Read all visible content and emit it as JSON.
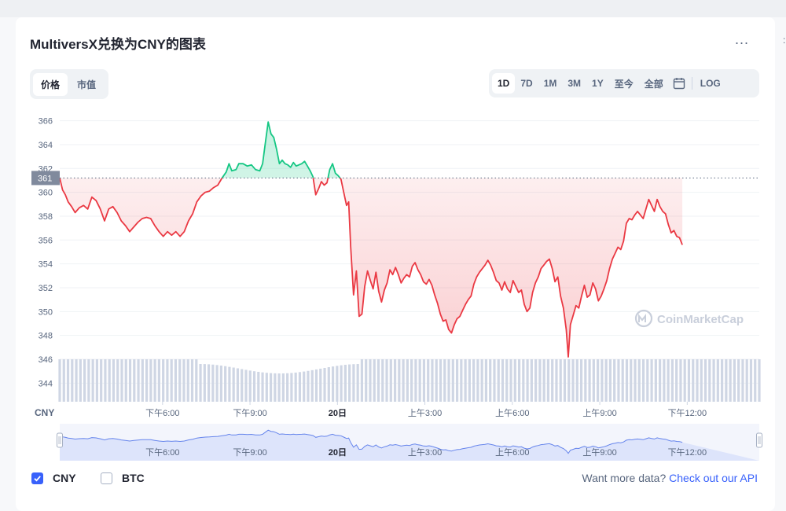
{
  "title": "MultiversX兑换为CNY的图表",
  "more_label": "...",
  "edge_char": ":",
  "metric_tabs": [
    {
      "label": "价格",
      "active": true
    },
    {
      "label": "市值",
      "active": false
    }
  ],
  "range_tabs": [
    {
      "label": "1D",
      "active": true
    },
    {
      "label": "7D",
      "active": false
    },
    {
      "label": "1M",
      "active": false
    },
    {
      "label": "3M",
      "active": false
    },
    {
      "label": "1Y",
      "active": false
    },
    {
      "label": "至今",
      "active": false
    },
    {
      "label": "全部",
      "active": false
    }
  ],
  "calendar_icon": "calendar-icon",
  "log_label": "LOG",
  "legend": [
    {
      "label": "CNY",
      "checked": true
    },
    {
      "label": "BTC",
      "checked": false
    }
  ],
  "more_data": {
    "text": "Want more data? ",
    "link": "Check out our API"
  },
  "watermark": "CoinMarketCap",
  "colors": {
    "up": "#16c784",
    "down": "#ea3943",
    "accent": "#3861fb",
    "volume": "#cfd6e4",
    "navigator_fill": "#dde4fb",
    "navigator_line": "#6685ec"
  },
  "chart_data": {
    "type": "line",
    "baseline": 361.2,
    "baseline_label": "361",
    "currency_label": "CNY",
    "yticks": [
      366,
      364,
      362,
      360,
      358,
      356,
      354,
      352,
      350,
      348,
      346,
      344
    ],
    "ylim": [
      343,
      367
    ],
    "xlim": [
      0,
      1
    ],
    "xticks": [
      {
        "t": 0.147,
        "label": "下午6:00",
        "bold": false
      },
      {
        "t": 0.272,
        "label": "下午9:00",
        "bold": false
      },
      {
        "t": 0.397,
        "label": "20日",
        "bold": true
      },
      {
        "t": 0.522,
        "label": "上午3:00",
        "bold": false
      },
      {
        "t": 0.647,
        "label": "上午6:00",
        "bold": false
      },
      {
        "t": 0.772,
        "label": "上午9:00",
        "bold": false
      },
      {
        "t": 0.897,
        "label": "下午12:00",
        "bold": false
      }
    ],
    "series": [
      {
        "name": "CNY",
        "points": [
          [
            0,
            361.2
          ],
          [
            0.004,
            360.2
          ],
          [
            0.008,
            359.8
          ],
          [
            0.012,
            359.2
          ],
          [
            0.017,
            358.8
          ],
          [
            0.022,
            358.3
          ],
          [
            0.028,
            358.7
          ],
          [
            0.034,
            358.9
          ],
          [
            0.04,
            358.6
          ],
          [
            0.046,
            359.6
          ],
          [
            0.052,
            359.3
          ],
          [
            0.058,
            358.6
          ],
          [
            0.064,
            357.6
          ],
          [
            0.07,
            358.6
          ],
          [
            0.076,
            358.8
          ],
          [
            0.082,
            358.3
          ],
          [
            0.088,
            357.6
          ],
          [
            0.094,
            357.2
          ],
          [
            0.1,
            356.7
          ],
          [
            0.106,
            357.1
          ],
          [
            0.112,
            357.5
          ],
          [
            0.118,
            357.8
          ],
          [
            0.124,
            357.9
          ],
          [
            0.13,
            357.8
          ],
          [
            0.136,
            357.2
          ],
          [
            0.142,
            356.7
          ],
          [
            0.148,
            356.3
          ],
          [
            0.154,
            356.7
          ],
          [
            0.16,
            356.4
          ],
          [
            0.166,
            356.7
          ],
          [
            0.172,
            356.3
          ],
          [
            0.178,
            356.7
          ],
          [
            0.184,
            357.6
          ],
          [
            0.19,
            358.2
          ],
          [
            0.196,
            359.2
          ],
          [
            0.202,
            359.7
          ],
          [
            0.208,
            360
          ],
          [
            0.214,
            360.1
          ],
          [
            0.22,
            360.4
          ],
          [
            0.226,
            360.6
          ],
          [
            0.232,
            361.2
          ],
          [
            0.238,
            361.7
          ],
          [
            0.242,
            362.4
          ],
          [
            0.246,
            361.8
          ],
          [
            0.252,
            361.9
          ],
          [
            0.256,
            362.4
          ],
          [
            0.262,
            362.4
          ],
          [
            0.268,
            362.2
          ],
          [
            0.274,
            362.3
          ],
          [
            0.28,
            361.9
          ],
          [
            0.286,
            361.8
          ],
          [
            0.29,
            362.4
          ],
          [
            0.294,
            364.2
          ],
          [
            0.298,
            365.9
          ],
          [
            0.302,
            364.9
          ],
          [
            0.306,
            364.6
          ],
          [
            0.31,
            363.6
          ],
          [
            0.314,
            362.4
          ],
          [
            0.318,
            362.7
          ],
          [
            0.322,
            362.4
          ],
          [
            0.326,
            362.3
          ],
          [
            0.33,
            362.1
          ],
          [
            0.334,
            362.5
          ],
          [
            0.338,
            362.2
          ],
          [
            0.342,
            362.3
          ],
          [
            0.346,
            362.4
          ],
          [
            0.35,
            362.6
          ],
          [
            0.354,
            362.2
          ],
          [
            0.358,
            361.8
          ],
          [
            0.362,
            361.3
          ],
          [
            0.366,
            359.8
          ],
          [
            0.37,
            360.3
          ],
          [
            0.374,
            360.9
          ],
          [
            0.378,
            360.6
          ],
          [
            0.382,
            360.8
          ],
          [
            0.386,
            361.9
          ],
          [
            0.39,
            362.4
          ],
          [
            0.394,
            361.6
          ],
          [
            0.398,
            361.4
          ],
          [
            0.402,
            361.1
          ],
          [
            0.406,
            360
          ],
          [
            0.41,
            358.9
          ],
          [
            0.413,
            359.2
          ],
          [
            0.416,
            355.4
          ],
          [
            0.42,
            351.4
          ],
          [
            0.424,
            353.4
          ],
          [
            0.428,
            349.6
          ],
          [
            0.432,
            349.8
          ],
          [
            0.436,
            352.1
          ],
          [
            0.44,
            353.4
          ],
          [
            0.444,
            352.6
          ],
          [
            0.448,
            351.9
          ],
          [
            0.452,
            353.3
          ],
          [
            0.456,
            351.7
          ],
          [
            0.46,
            350.8
          ],
          [
            0.464,
            351.8
          ],
          [
            0.468,
            352.4
          ],
          [
            0.472,
            353.5
          ],
          [
            0.476,
            353.1
          ],
          [
            0.48,
            353.7
          ],
          [
            0.484,
            353.1
          ],
          [
            0.488,
            352.4
          ],
          [
            0.492,
            352.8
          ],
          [
            0.496,
            353.1
          ],
          [
            0.5,
            352.9
          ],
          [
            0.504,
            353.8
          ],
          [
            0.508,
            354.1
          ],
          [
            0.512,
            353.5
          ],
          [
            0.516,
            353.1
          ],
          [
            0.52,
            352.5
          ],
          [
            0.524,
            352.3
          ],
          [
            0.528,
            352.7
          ],
          [
            0.532,
            352.2
          ],
          [
            0.536,
            351.4
          ],
          [
            0.54,
            350.7
          ],
          [
            0.544,
            349.8
          ],
          [
            0.548,
            349.2
          ],
          [
            0.552,
            349.3
          ],
          [
            0.556,
            348.5
          ],
          [
            0.56,
            348.2
          ],
          [
            0.564,
            348.9
          ],
          [
            0.568,
            349.4
          ],
          [
            0.572,
            349.6
          ],
          [
            0.576,
            350.1
          ],
          [
            0.58,
            350.6
          ],
          [
            0.584,
            351
          ],
          [
            0.588,
            351.3
          ],
          [
            0.592,
            352.3
          ],
          [
            0.596,
            352.9
          ],
          [
            0.6,
            353.3
          ],
          [
            0.604,
            353.6
          ],
          [
            0.608,
            353.9
          ],
          [
            0.612,
            354.3
          ],
          [
            0.616,
            353.9
          ],
          [
            0.62,
            353.3
          ],
          [
            0.624,
            352.6
          ],
          [
            0.628,
            352.4
          ],
          [
            0.632,
            351.8
          ],
          [
            0.636,
            352.5
          ],
          [
            0.64,
            351.9
          ],
          [
            0.644,
            351.6
          ],
          [
            0.648,
            352.6
          ],
          [
            0.652,
            352.1
          ],
          [
            0.656,
            351.6
          ],
          [
            0.66,
            351.8
          ],
          [
            0.664,
            350.6
          ],
          [
            0.668,
            350
          ],
          [
            0.672,
            350.3
          ],
          [
            0.676,
            351.6
          ],
          [
            0.68,
            352.4
          ],
          [
            0.684,
            352.9
          ],
          [
            0.688,
            353.6
          ],
          [
            0.692,
            353.9
          ],
          [
            0.696,
            354.2
          ],
          [
            0.7,
            354.4
          ],
          [
            0.704,
            353.6
          ],
          [
            0.708,
            352.5
          ],
          [
            0.712,
            352.9
          ],
          [
            0.716,
            351.3
          ],
          [
            0.72,
            350.3
          ],
          [
            0.724,
            348.5
          ],
          [
            0.727,
            346.2
          ],
          [
            0.73,
            348.9
          ],
          [
            0.734,
            349.7
          ],
          [
            0.738,
            350.5
          ],
          [
            0.742,
            350.3
          ],
          [
            0.746,
            351.3
          ],
          [
            0.75,
            352.2
          ],
          [
            0.754,
            351.2
          ],
          [
            0.758,
            351.4
          ],
          [
            0.762,
            352.4
          ],
          [
            0.766,
            351.9
          ],
          [
            0.77,
            350.9
          ],
          [
            0.774,
            351.3
          ],
          [
            0.778,
            351.9
          ],
          [
            0.782,
            352.6
          ],
          [
            0.786,
            353.6
          ],
          [
            0.79,
            354.4
          ],
          [
            0.794,
            354.9
          ],
          [
            0.798,
            355.4
          ],
          [
            0.802,
            355.2
          ],
          [
            0.806,
            355.9
          ],
          [
            0.81,
            357.4
          ],
          [
            0.814,
            357.8
          ],
          [
            0.818,
            357.7
          ],
          [
            0.822,
            358.1
          ],
          [
            0.826,
            358.4
          ],
          [
            0.83,
            358.1
          ],
          [
            0.834,
            357.8
          ],
          [
            0.838,
            358.6
          ],
          [
            0.842,
            359.4
          ],
          [
            0.846,
            358.9
          ],
          [
            0.85,
            358.4
          ],
          [
            0.854,
            359.4
          ],
          [
            0.858,
            358.8
          ],
          [
            0.862,
            358.4
          ],
          [
            0.866,
            358.2
          ],
          [
            0.87,
            357.3
          ],
          [
            0.874,
            356.6
          ],
          [
            0.878,
            356.8
          ],
          [
            0.882,
            356.3
          ],
          [
            0.886,
            356.2
          ],
          [
            0.89,
            355.6
          ]
        ]
      }
    ]
  }
}
